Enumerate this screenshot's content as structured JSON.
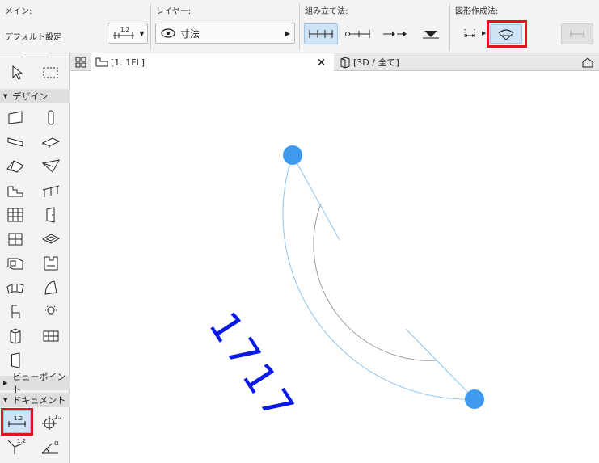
{
  "toolbar": {
    "main": {
      "title": "メイン:",
      "default_label": "デフォルト設定",
      "preset_badge": "1.2"
    },
    "layer": {
      "title": "レイヤー:",
      "value": "寸法"
    },
    "construction": {
      "title": "組み立て法:"
    },
    "geometry": {
      "title": "図形作成法:"
    }
  },
  "tabs": [
    {
      "label": "[1. 1FL]",
      "close": "×"
    },
    {
      "label": "[3D / 全て]"
    }
  ],
  "palette": {
    "design_header": "デザイン",
    "viewpoint_header": "ビューポイント",
    "document_header": "ドキュメント",
    "doc_badge": "1.2",
    "angle_badge": "α"
  },
  "canvas": {
    "dimension_value": "1717",
    "colors": {
      "dim_text": "#0b19e6",
      "handle": "#3d9aee",
      "arc": "#8fc3ee",
      "inner_arc": "#9a9a9a"
    }
  },
  "accent": {
    "highlight": "#e0141e",
    "selected": "#cfe3f7"
  }
}
